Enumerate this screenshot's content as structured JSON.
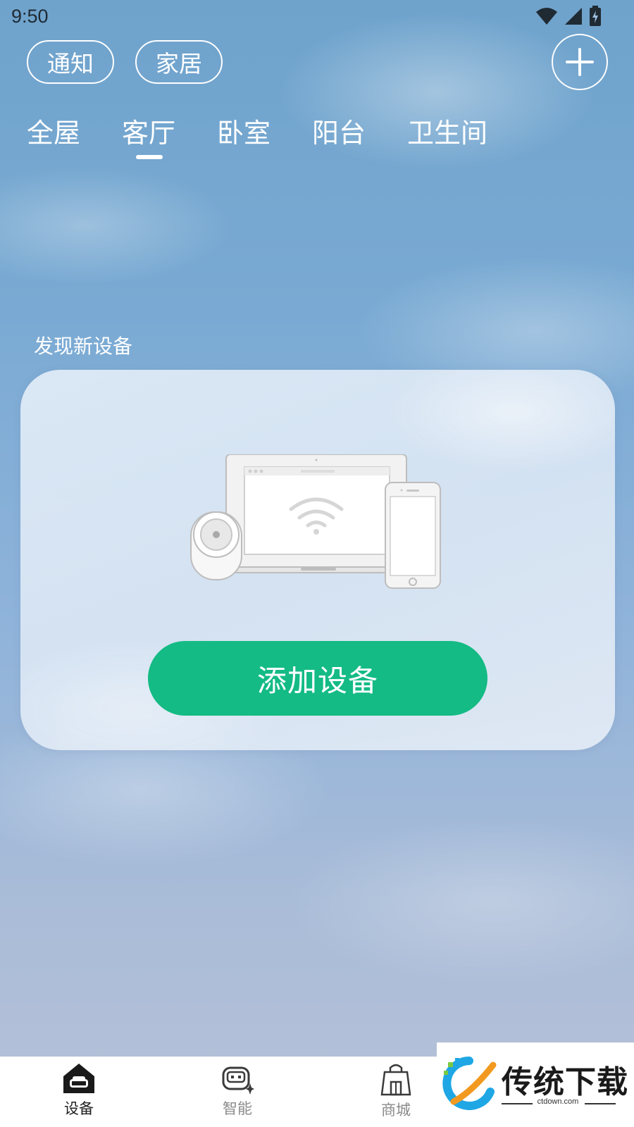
{
  "status_bar": {
    "time": "9:50",
    "icons": [
      "wifi-icon",
      "cellular-signal-icon",
      "battery-charging-icon"
    ]
  },
  "header": {
    "pills": [
      {
        "label": "通知"
      },
      {
        "label": "家居"
      }
    ],
    "add_icon": "plus-icon"
  },
  "room_tabs": {
    "items": [
      {
        "label": "全屋"
      },
      {
        "label": "客厅"
      },
      {
        "label": "卧室"
      },
      {
        "label": "阳台"
      },
      {
        "label": "卫生间"
      }
    ],
    "selected": "客厅"
  },
  "discover": {
    "title": "发现新设备",
    "illustration": "devices-illustration",
    "button_label": "添加设备",
    "button_color": "#14bb84"
  },
  "bottom_nav": {
    "items": [
      {
        "label": "设备",
        "icon": "home-sofa-icon",
        "active": true
      },
      {
        "label": "智能",
        "icon": "robot-icon",
        "active": false
      },
      {
        "label": "商城",
        "icon": "shopping-bag-icon",
        "active": false
      }
    ]
  },
  "watermark": {
    "brand": "传统下载",
    "domain": "ctdown.com"
  }
}
